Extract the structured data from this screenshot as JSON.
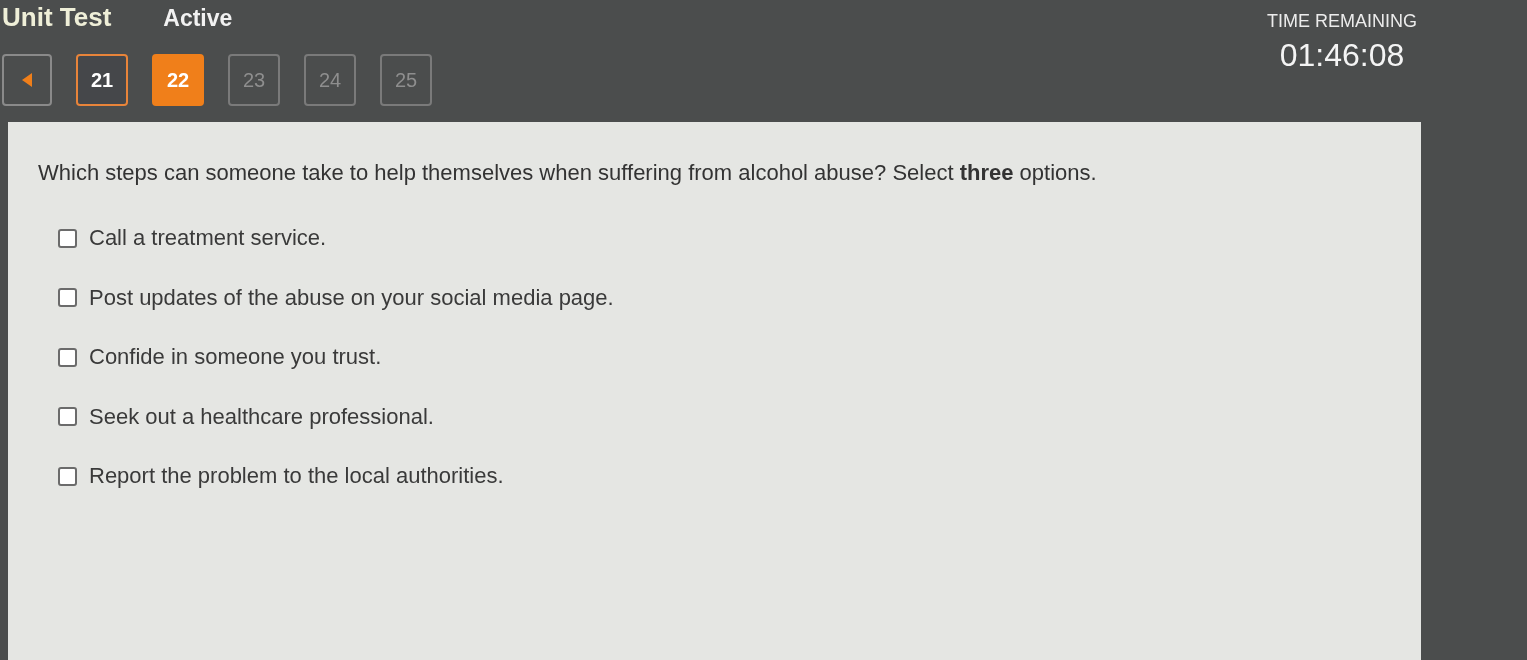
{
  "header": {
    "title": "Unit Test",
    "status": "Active"
  },
  "navigation": {
    "questions": [
      {
        "number": "21",
        "selected": false,
        "visited": true
      },
      {
        "number": "22",
        "selected": true,
        "visited": true
      },
      {
        "number": "23",
        "selected": false,
        "visited": false
      },
      {
        "number": "24",
        "selected": false,
        "visited": false
      },
      {
        "number": "25",
        "selected": false,
        "visited": false
      }
    ]
  },
  "timer": {
    "label": "TIME REMAINING",
    "value": "01:46:08"
  },
  "question": {
    "prompt": "Which steps can someone take to help themselves when suffering from alcohol abuse? Select **three** options.",
    "options": [
      {
        "text": "Call a treatment service.",
        "checked": false
      },
      {
        "text": "Post updates of the abuse on your social media page.",
        "checked": false
      },
      {
        "text": "Confide in someone you trust.",
        "checked": false
      },
      {
        "text": "Seek out a healthcare professional.",
        "checked": false
      },
      {
        "text": "Report the problem to the local authorities.",
        "checked": false
      }
    ]
  }
}
